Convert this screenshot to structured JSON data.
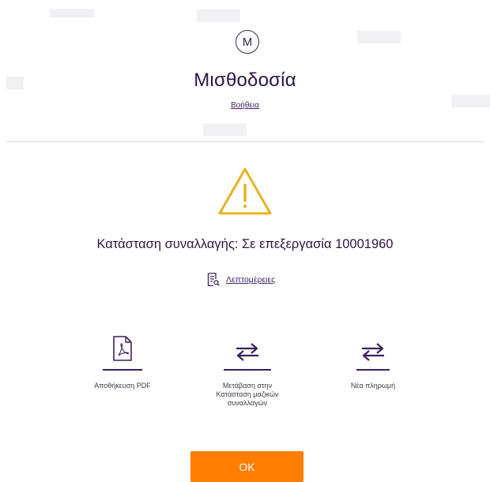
{
  "header": {
    "logo_letter": "M",
    "title": "Μισθοδοσία",
    "help_link": "Βοήθεια"
  },
  "status": {
    "text": "Κατάσταση συναλλαγής: Σε επεξεργασία 10001960",
    "icon": "warning-triangle-icon",
    "icon_color": "#e8b321"
  },
  "details": {
    "label": "Λεπτομέρειες",
    "icon": "document-search-icon"
  },
  "actions": [
    {
      "label": "Αποθήκευση PDF",
      "icon": "pdf-file-icon"
    },
    {
      "label_lines": [
        "Μετάβαση στην",
        "Κατάσταση μαζικών",
        "συναλλαγών"
      ],
      "icon": "transfer-arrows-icon"
    },
    {
      "label": "Νέα πληρωμή",
      "icon": "transfer-arrows-icon"
    }
  ],
  "ok_button": {
    "label": "OK",
    "color": "#ff7d00"
  },
  "colors": {
    "primary": "#3d1f5e",
    "text": "#2a1646",
    "accent": "#ff7d00"
  }
}
